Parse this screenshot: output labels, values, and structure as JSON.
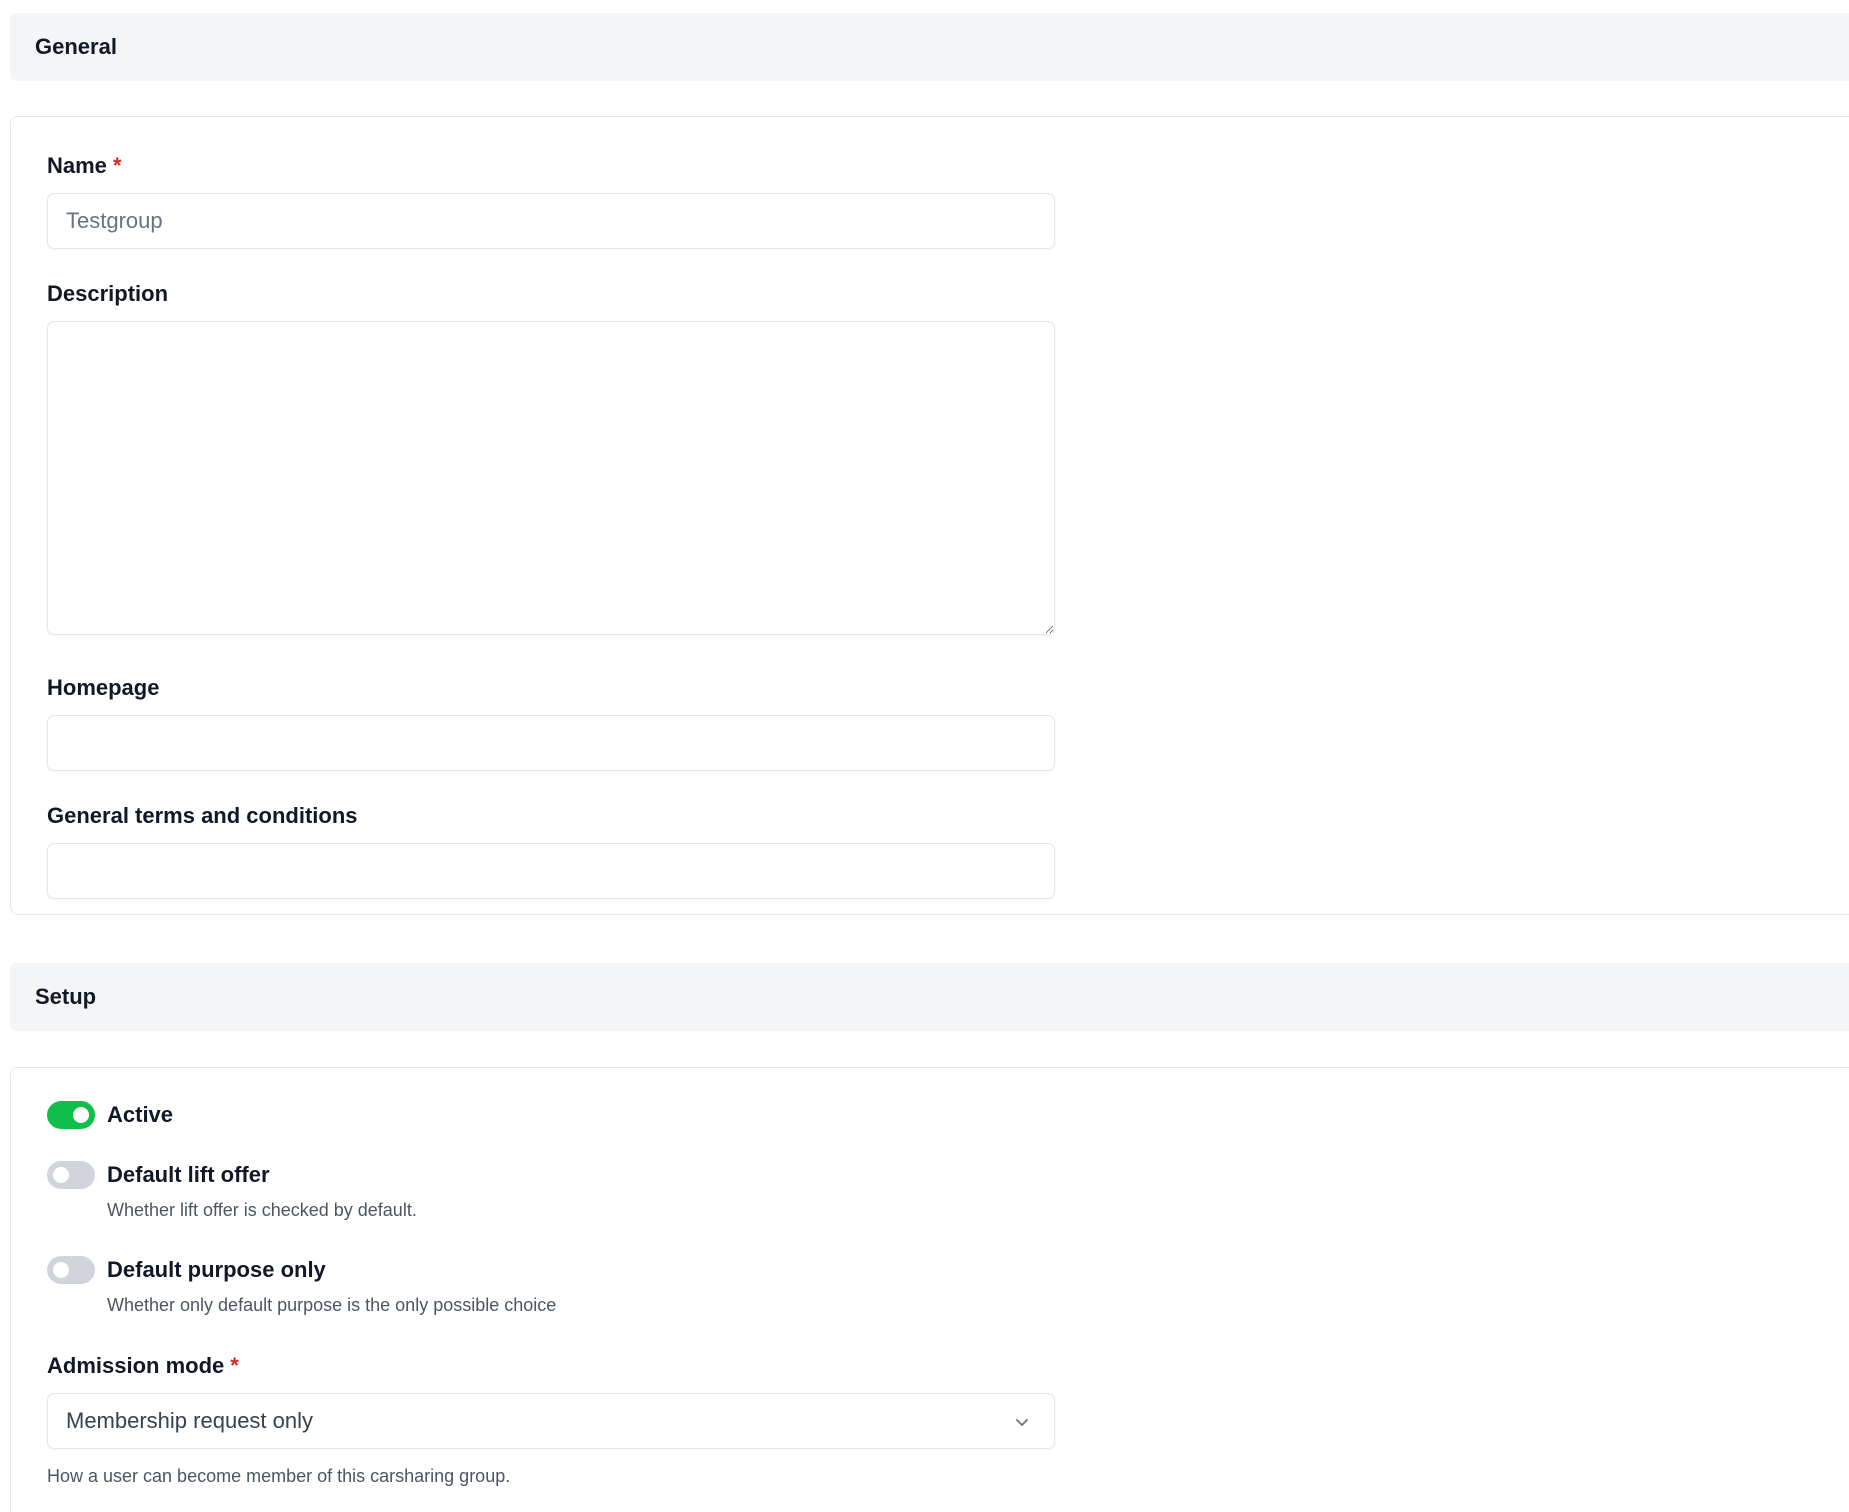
{
  "general": {
    "title": "General",
    "name": {
      "label": "Name",
      "required_mark": "*",
      "placeholder": "Testgroup",
      "value": ""
    },
    "description": {
      "label": "Description",
      "value": ""
    },
    "homepage": {
      "label": "Homepage",
      "value": ""
    },
    "terms": {
      "label": "General terms and conditions",
      "value": ""
    }
  },
  "setup": {
    "title": "Setup",
    "toggles": [
      {
        "label": "Active",
        "checked": true,
        "help": ""
      },
      {
        "label": "Default lift offer",
        "checked": false,
        "help": "Whether lift offer is checked by default."
      },
      {
        "label": "Default purpose only",
        "checked": false,
        "help": "Whether only default purpose is the only possible choice"
      }
    ],
    "admission_mode": {
      "label": "Admission mode",
      "required_mark": "*",
      "selected": "Membership request only",
      "help": "How a user can become member of this carsharing group."
    }
  },
  "colors": {
    "toggle_on": "#0fbf4a",
    "toggle_off": "#d1d5db",
    "required": "#dc2626",
    "section_header_bg": "#f4f5f7"
  }
}
